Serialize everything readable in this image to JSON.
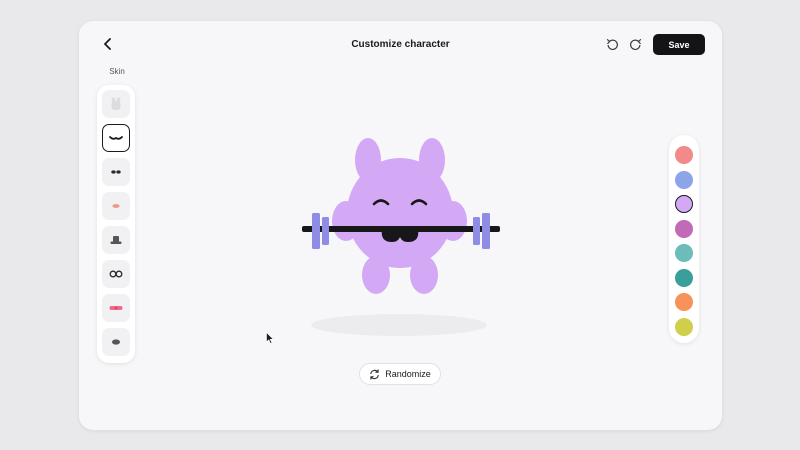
{
  "header": {
    "title": "Customize character",
    "back_icon": "chevron-left-icon",
    "undo_icon": "undo-icon",
    "redo_icon": "redo-icon",
    "save_label": "Save"
  },
  "skin": {
    "label": "Skin",
    "selected_index": 1,
    "items": [
      {
        "name": "blank",
        "icon": "blank-skin-icon"
      },
      {
        "name": "mustache",
        "icon": "mustache-icon"
      },
      {
        "name": "eyes",
        "icon": "eyes-icon"
      },
      {
        "name": "blush",
        "icon": "blush-icon"
      },
      {
        "name": "hat",
        "icon": "hat-icon"
      },
      {
        "name": "glasses",
        "icon": "glasses-icon"
      },
      {
        "name": "bowtie",
        "icon": "bowtie-icon"
      },
      {
        "name": "shadow",
        "icon": "shadow-icon"
      }
    ]
  },
  "colors": {
    "selected_index": 2,
    "swatches": [
      "#f28a8a",
      "#8ea4e8",
      "#d3a9f5",
      "#c06ab8",
      "#6cbcba",
      "#3a9f9b",
      "#f6925a",
      "#cfcf4c"
    ]
  },
  "character": {
    "body_color": "#d3a9f5",
    "barbell_plate_color": "#8f8ce6"
  },
  "randomize": {
    "label": "Randomize",
    "icon": "refresh-icon"
  }
}
